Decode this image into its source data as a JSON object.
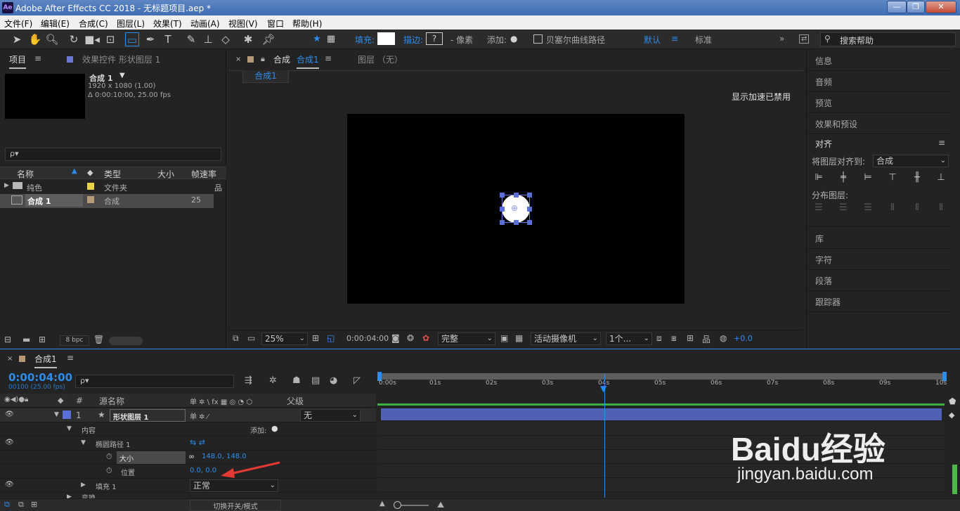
{
  "window": {
    "app_icon": "Ae",
    "title": "Adobe After Effects CC 2018 - 无标题项目.aep *",
    "minimize": "—",
    "maximize": "❐",
    "close": "✕"
  },
  "menu": [
    "文件(F)",
    "编辑(E)",
    "合成(C)",
    "图层(L)",
    "效果(T)",
    "动画(A)",
    "视图(V)",
    "窗口",
    "帮助(H)"
  ],
  "toolbar": {
    "fill_label": "填充:",
    "stroke_label": "描边:",
    "stroke_value": "?",
    "pixels_label": "- 像素",
    "add_label": "添加:",
    "bezier_label": "贝塞尔曲线路径",
    "workspace_default": "默认",
    "workspace_standard": "标准",
    "search_placeholder": "搜索帮助"
  },
  "project_panel": {
    "tab_project": "项目",
    "tab_effects": "效果控件 形状图层 1",
    "comp_name": "合成 1",
    "comp_info_size": "1920 x 1080 (1.00)",
    "comp_info_duration": "Δ 0:00:10:00, 25.00 fps",
    "search_placeholder": "ρ▾",
    "columns": [
      "名称",
      "类型",
      "大小",
      "帧速率"
    ],
    "items": [
      {
        "name": "纯色",
        "type": "文件夹",
        "size": "",
        "fps": "",
        "color": "#e8d24a"
      },
      {
        "name": "合成 1",
        "type": "合成",
        "size": "",
        "fps": "25",
        "color": "#b69a78"
      }
    ],
    "bpc": "8 bpc"
  },
  "composition_panel": {
    "tab_label": "合成",
    "tab_name": "合成1",
    "layer_tab": "图层 （无）",
    "breadcrumb": "合成1",
    "accel_notice": "显示加速已禁用",
    "zoom": "25%",
    "timecode": "0:00:04:00",
    "quality": "完整",
    "camera": "活动摄像机",
    "views": "1个...",
    "exposure": "+0.0"
  },
  "right_panel": {
    "items_top": [
      "信息",
      "音频",
      "预览",
      "效果和预设"
    ],
    "align_title": "对齐",
    "align_to_label": "将图层对齐到:",
    "align_to_value": "合成",
    "distribute_label": "分布图层:",
    "items_bottom": [
      "库",
      "字符",
      "段落",
      "跟踪器"
    ]
  },
  "timeline": {
    "tab_name": "合成1",
    "timecode": "0:00:04:00",
    "frame_info": "00100 (25.00 fps)",
    "search_placeholder": "ρ▾",
    "col_source": "源名称",
    "col_parent": "父级",
    "col_switches": "单 ✲ \\ fx ▦ ◎ ◔ ⬡",
    "layer_num": "1",
    "layer_name": "形状图层 1",
    "layer_parent": "无",
    "contents_label": "内容",
    "add_label": "添加:",
    "ellipse_label": "椭圆路径 1",
    "size_label": "大小",
    "size_value": "148.0, 148.0",
    "position_label": "位置",
    "position_value": "0.0, 0.0",
    "fill_label": "填充 1",
    "fill_mode": "正常",
    "transform_label": "变换",
    "toggle_label": "切换开关/模式",
    "ruler": [
      "0:00s",
      "01s",
      "02s",
      "03s",
      "04s",
      "05s",
      "06s",
      "07s",
      "08s",
      "09s",
      "10s"
    ],
    "current_time_fraction": 0.4
  },
  "watermark": {
    "brand": "Baidu经验",
    "url": "jingyan.baidu.com"
  },
  "colors": {
    "accent": "#2d8ceb",
    "layer_bar": "#4f60b5",
    "label_blue": "#5a6fd8",
    "titlebar": "#4a76bb"
  }
}
